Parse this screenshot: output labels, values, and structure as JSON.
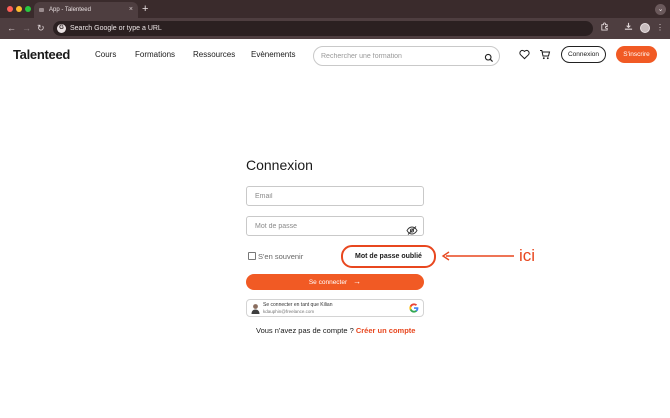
{
  "browser": {
    "tab_title": "App - Talenteed",
    "tab_close": "×",
    "new_tab": "+",
    "omnibox_placeholder": "Search Google or type a URL",
    "google_letter": "G"
  },
  "header": {
    "logo": "Talenteed",
    "nav": [
      "Cours",
      "Formations",
      "Ressources",
      "Evènements"
    ],
    "search_placeholder": "Rechercher une formation",
    "login_label": "Connexion",
    "signup_label": "S'inscrire"
  },
  "login": {
    "title": "Connexion",
    "email_placeholder": "Email",
    "password_placeholder": "Mot de passe",
    "remember_label": "S'en souvenir",
    "forgot_label": "Mot de passe oublié",
    "submit_label": "Se connecter",
    "submit_arrow": "→",
    "google_name": "Se connecter en tant que Kilian",
    "google_email": "kdauphin@freelance.com",
    "no_account": "Vous n'avez pas de compte ?",
    "create_account": "Créer un compte"
  },
  "annotation": {
    "text": "ici",
    "color": "#e8471f"
  },
  "colors": {
    "brand": "#f15a24",
    "chrome_dark": "#3a2b2c"
  }
}
